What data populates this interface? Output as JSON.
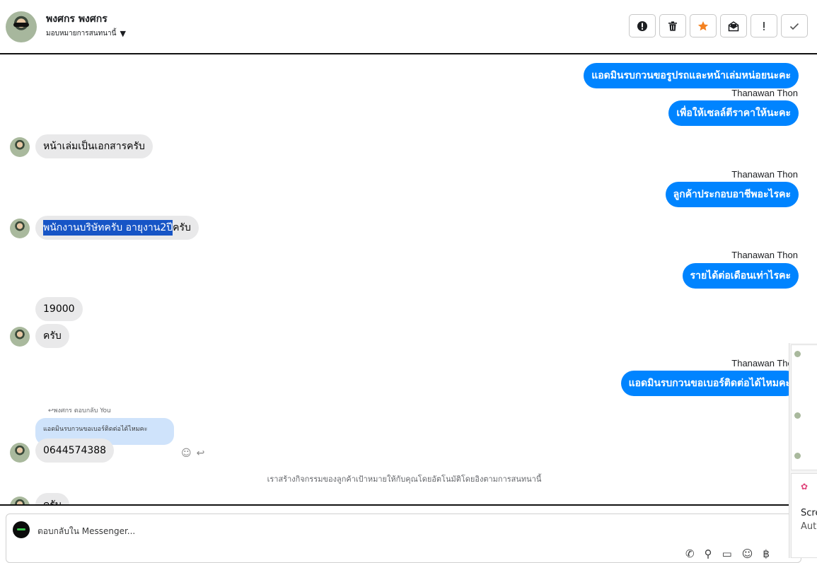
{
  "header": {
    "contact_name": "พงศกร พงศกร",
    "assign_label": "มอบหมายการสนทนานี้",
    "assign_caret": "▼",
    "toolbar": [
      {
        "name": "spam-button",
        "icon": "alert-circle-icon"
      },
      {
        "name": "delete-button",
        "icon": "trash-icon"
      },
      {
        "name": "star-button",
        "icon": "star-icon"
      },
      {
        "name": "mark-unread-button",
        "icon": "envelope-open-icon"
      },
      {
        "name": "follow-up-button",
        "icon": "exclamation-icon"
      },
      {
        "name": "mark-done-button",
        "icon": "check-icon"
      }
    ],
    "accent_star": "#f48120"
  },
  "messages": {
    "out1": "แอดมินรบกวนขอรูปรถและหน้าเล่มหน่อยนะคะ",
    "sender1": "Thanawan Thon",
    "out2": "เพื่อให้เซลล์ตีราคาให้นะคะ",
    "in1": "หน้าเล่มเป็นเอกสารครับ",
    "sender2": "Thanawan Thon",
    "out3": "ลูกค้าประกอบอาชีพอะไรคะ",
    "in2_highlight": "พนักงานบริษัทครับ อายุงาน2ปี",
    "in2_rest": "ครับ",
    "sender3": "Thanawan Thon",
    "out4": "รายได้ต่อเดือนเท่าไรคะ",
    "in3": "19000",
    "in4": "ครับ",
    "sender4": "Thanawan Thon",
    "out5": "แอดมินรบกวนขอเบอร์ติดต่อได้ไหมคะ",
    "reply_label": "↩พงศกร ตอบกลับ You",
    "reply_quote": "แอดมินรบกวนขอเบอร์ติดต่อได้ไหมคะ",
    "in5": "0644574388",
    "notice": "เราสร้างกิจกรรมของลูกค้าเป้าหมายให้กับคุณโดยอัตโนมัติโดยอิงตามการสนทนานี้",
    "in6_partial": "ครับ"
  },
  "composer": {
    "placeholder": "ตอบกลับใน Messenger...",
    "icons": [
      "phone-add-icon",
      "paperclip-icon",
      "chat-bubble-icon",
      "emoji-icon",
      "baht-icon"
    ]
  },
  "side_panel": {
    "line1": "Scre",
    "line2": "Auto"
  },
  "colors": {
    "outgoing_bubble": "#0084ff",
    "incoming_bubble": "#e9e9ea",
    "highlight": "#1755c6",
    "reply_quote": "#cfe3fb"
  }
}
